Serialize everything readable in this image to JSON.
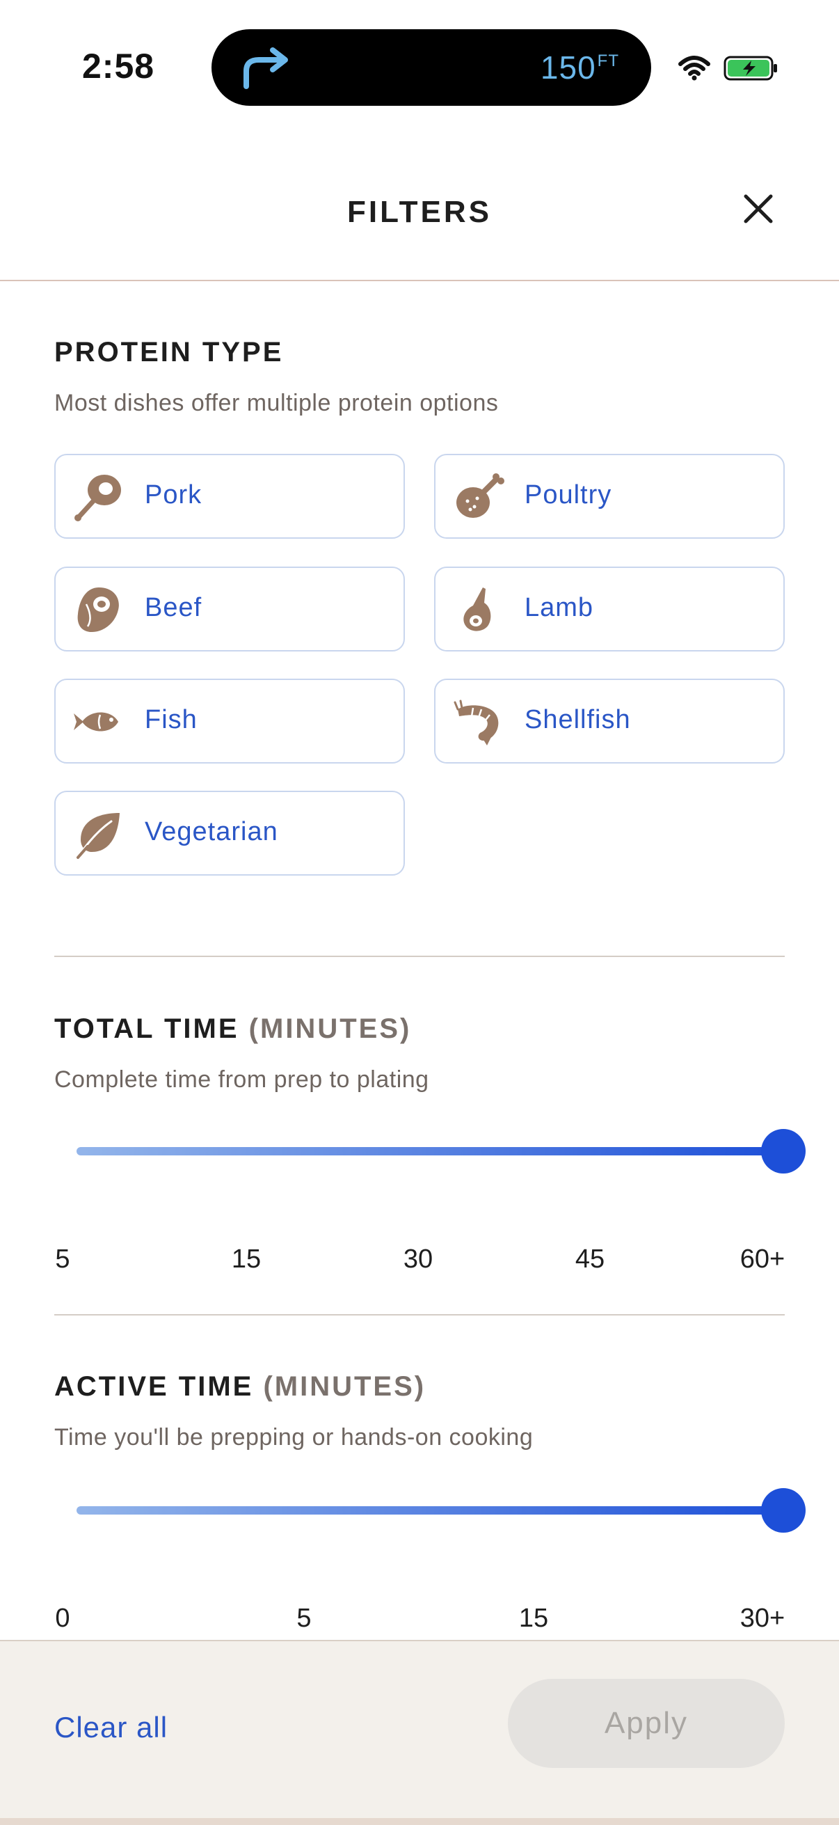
{
  "status_bar": {
    "time": "2:58",
    "navigation_distance": "150",
    "navigation_unit": "FT",
    "icons": [
      "turn-right-arrow-icon",
      "wifi-icon",
      "battery-charging-icon"
    ]
  },
  "header": {
    "title": "FILTERS",
    "close_icon": "close-icon"
  },
  "protein": {
    "title": "PROTEIN TYPE",
    "subtitle": "Most dishes offer multiple protein options",
    "options": [
      {
        "label": "Pork",
        "icon": "ham-leg-icon"
      },
      {
        "label": "Poultry",
        "icon": "drumstick-icon"
      },
      {
        "label": "Beef",
        "icon": "steak-icon"
      },
      {
        "label": "Lamb",
        "icon": "lamb-shank-icon"
      },
      {
        "label": "Fish",
        "icon": "fish-icon"
      },
      {
        "label": "Shellfish",
        "icon": "shrimp-icon"
      },
      {
        "label": "Vegetarian",
        "icon": "leaf-icon"
      }
    ],
    "icon_color": "#9b7a63",
    "label_color": "#2a56c6"
  },
  "total_time": {
    "title": "TOTAL TIME",
    "unit": "(MINUTES)",
    "subtitle": "Complete time from prep to plating",
    "ticks": [
      "5",
      "15",
      "30",
      "45",
      "60+"
    ],
    "selected": "60+",
    "fill_fraction": 1.0
  },
  "active_time": {
    "title": "ACTIVE TIME",
    "unit": "(MINUTES)",
    "subtitle": "Time you'll be prepping or hands-on cooking",
    "ticks": [
      "0",
      "5",
      "15",
      "30+"
    ],
    "selected": "30+",
    "fill_fraction": 1.0
  },
  "footer": {
    "clear_label": "Clear all",
    "apply_label": "Apply",
    "apply_enabled": false
  },
  "colors": {
    "accent": "#1d4fd8",
    "slider_start": "#93b5ea",
    "text_dark": "#1e1e1e",
    "text_muted": "#6e6560",
    "footer_bg": "#f3f0eb"
  }
}
